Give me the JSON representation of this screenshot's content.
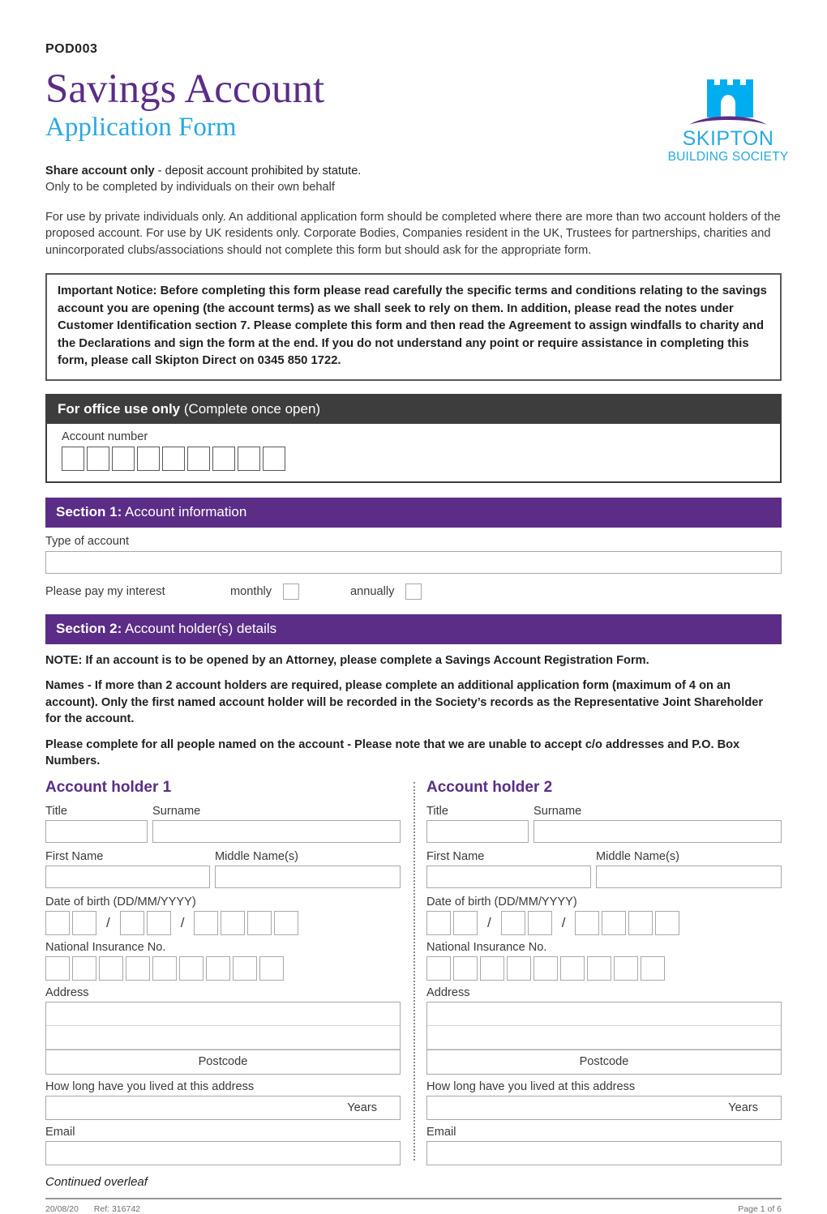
{
  "header": {
    "doc_code": "POD003",
    "title_main": "Savings Account",
    "title_sub": "Application Form",
    "logo_name": "SKIPTON",
    "logo_sub": "BUILDING SOCIETY"
  },
  "colors": {
    "purple": "#5b2d86",
    "cyan": "#27aae1",
    "dark_bar": "#3d3d3d",
    "border_grey": "#a7a9ac"
  },
  "intro": {
    "lead_bold": "Share account only",
    "lead_rest": " - deposit account prohibited by statute.",
    "lead_line2": "Only to be completed by individuals on their own behalf",
    "paragraph": "For use by private individuals only. An additional application form should be completed where there are more than two account holders of the proposed account. For use by UK residents only. Corporate Bodies, Companies resident in the UK, Trustees for partnerships, charities and unincorporated clubs/associations should not complete this form but should ask for the appropriate form."
  },
  "notice": {
    "text": "Important Notice: Before completing this form please read carefully the specific terms and conditions relating to the savings account you are opening (the account terms) as we shall seek to rely on them. In addition, please read the notes under Customer Identification section 7. Please complete this form and then read the Agreement to assign windfalls to charity and the Declarations and sign the form at the end. If you do not understand any point or require assistance in completing this form, please call Skipton Direct on 0345 850 1722."
  },
  "office_use": {
    "bar_bold": "For office use only",
    "bar_rest": " (Complete once open)",
    "account_number_label": "Account number",
    "account_number_boxes": 9
  },
  "section1": {
    "bar_bold": "Section 1:",
    "bar_rest": " Account information",
    "type_of_account_label": "Type of account",
    "type_of_account_value": "",
    "interest_label": "Please pay my interest",
    "interest_options": [
      "monthly",
      "annually"
    ]
  },
  "section2": {
    "bar_bold": "Section 2:",
    "bar_rest": " Account holder(s) details",
    "notes": [
      "NOTE: If an account is to be opened by an Attorney, please complete a Savings Account Registration Form.",
      "Names - If more than 2 account holders are required, please complete an additional application form (maximum of 4 on an account). Only the first named account holder will be recorded in the Society’s records as the Representative Joint Shareholder for the account.",
      "Please complete for all people named on the account - Please note that we are unable to accept c/o addresses and P.O. Box Numbers."
    ],
    "holders": [
      {
        "title": "Account holder 1",
        "labels": {
          "title": "Title",
          "surname": "Surname",
          "first_name": "First Name",
          "middle_names": "Middle Name(s)",
          "dob": "Date of birth (DD/MM/YYYY)",
          "ni": "National Insurance No.",
          "address": "Address",
          "postcode": "Postcode",
          "how_long": "How long have you lived at this address",
          "years": "Years",
          "email": "Email"
        },
        "values": {
          "title": "",
          "surname": "",
          "first_name": "",
          "middle_names": "",
          "address_line1": "",
          "address_line2": "",
          "postcode": "",
          "years": "",
          "email": ""
        },
        "dob_boxes": [
          2,
          2,
          4
        ],
        "dob_separator": "/",
        "ni_boxes": 9
      },
      {
        "title": "Account holder 2",
        "labels": {
          "title": "Title",
          "surname": "Surname",
          "first_name": "First Name",
          "middle_names": "Middle Name(s)",
          "dob": "Date of birth (DD/MM/YYYY)",
          "ni": "National Insurance No.",
          "address": "Address",
          "postcode": "Postcode",
          "how_long": "How long have you lived at this address",
          "years": "Years",
          "email": "Email"
        },
        "values": {
          "title": "",
          "surname": "",
          "first_name": "",
          "middle_names": "",
          "address_line1": "",
          "address_line2": "",
          "postcode": "",
          "years": "",
          "email": ""
        },
        "dob_boxes": [
          2,
          2,
          4
        ],
        "dob_separator": "/",
        "ni_boxes": 9
      }
    ]
  },
  "footer": {
    "continued": "Continued overleaf",
    "date": "20/08/20",
    "ref": "Ref: 316742",
    "page": "Page 1 of 6"
  }
}
